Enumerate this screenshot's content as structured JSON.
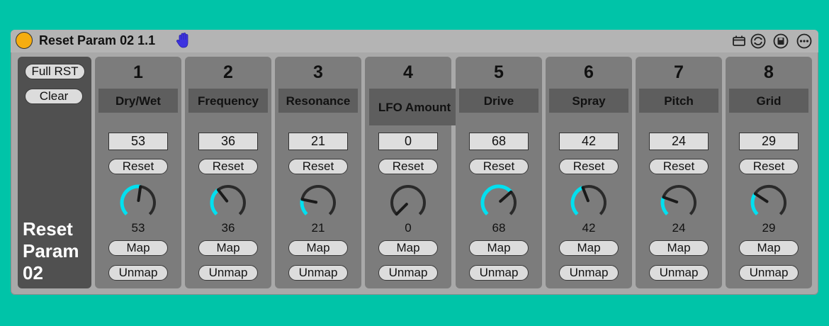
{
  "device": {
    "title": "Reset Param 02 1.1",
    "power_color": "#f5ad10",
    "accent_color": "#00c4a8",
    "knob_accent": "#00e0f0",
    "icons": [
      "power-button-icon",
      "hand-icon",
      "device-icon",
      "swap-icon",
      "save-icon",
      "more-options-icon"
    ]
  },
  "left_panel": {
    "full_reset_label": "Full RST",
    "clear_label": "Clear",
    "name_line1": "Reset",
    "name_line2": "Param",
    "name_line3": "02"
  },
  "params": [
    {
      "number": "1",
      "name": "Dry/Wet",
      "value": "53",
      "knob_value": "53",
      "reset_label": "Reset",
      "map_label": "Map",
      "unmap_label": "Unmap",
      "level": 0.53
    },
    {
      "number": "2",
      "name": "Frequency",
      "value": "36",
      "knob_value": "36",
      "reset_label": "Reset",
      "map_label": "Map",
      "unmap_label": "Unmap",
      "level": 0.36
    },
    {
      "number": "3",
      "name": "Resonance",
      "value": "21",
      "knob_value": "21",
      "reset_label": "Reset",
      "map_label": "Map",
      "unmap_label": "Unmap",
      "level": 0.21
    },
    {
      "number": "4",
      "name": "LFO Amount",
      "value": "0",
      "knob_value": "0",
      "reset_label": "Reset",
      "map_label": "Map",
      "unmap_label": "Unmap",
      "level": 0.0
    },
    {
      "number": "5",
      "name": "Drive",
      "value": "68",
      "knob_value": "68",
      "reset_label": "Reset",
      "map_label": "Map",
      "unmap_label": "Unmap",
      "level": 0.68
    },
    {
      "number": "6",
      "name": "Spray",
      "value": "42",
      "knob_value": "42",
      "reset_label": "Reset",
      "map_label": "Map",
      "unmap_label": "Unmap",
      "level": 0.42
    },
    {
      "number": "7",
      "name": "Pitch",
      "value": "24",
      "knob_value": "24",
      "reset_label": "Reset",
      "map_label": "Map",
      "unmap_label": "Unmap",
      "level": 0.24
    },
    {
      "number": "8",
      "name": "Grid",
      "value": "29",
      "knob_value": "29",
      "reset_label": "Reset",
      "map_label": "Map",
      "unmap_label": "Unmap",
      "level": 0.29
    }
  ]
}
